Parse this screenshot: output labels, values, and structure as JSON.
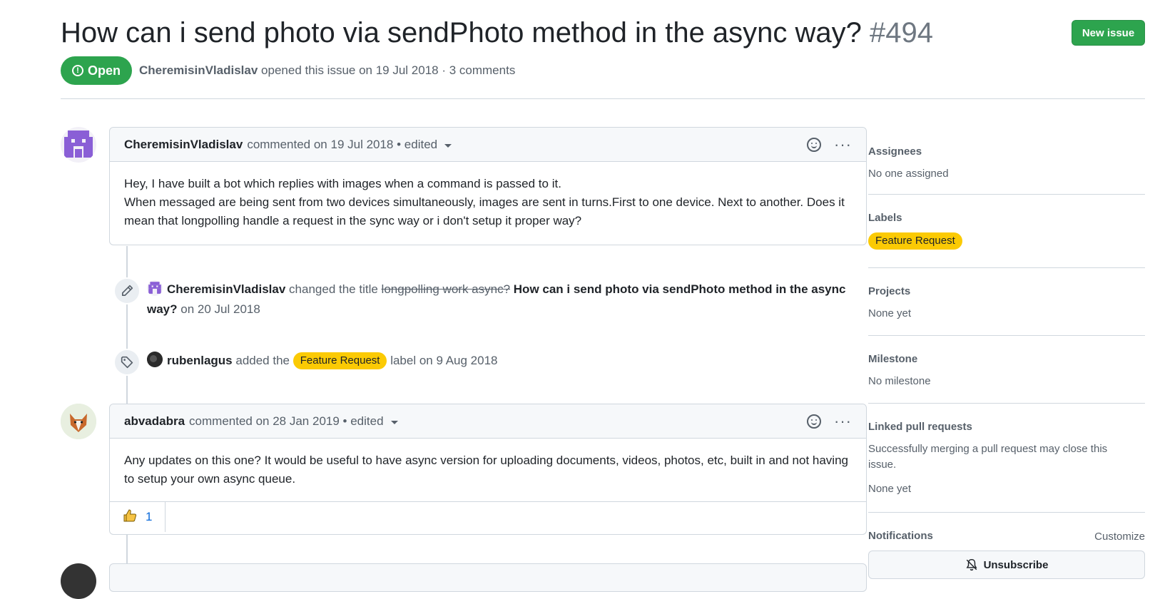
{
  "issue": {
    "title": "How can i send photo via sendPhoto method in the async way?",
    "number": "#494",
    "new_issue_label": "New issue",
    "state": "Open",
    "author": "CheremisinVladislav",
    "opened_text": "opened this issue on 19 Jul 2018 · 3 comments"
  },
  "timeline": {
    "comment1": {
      "author": "CheremisinVladislav",
      "meta": "commented on 19 Jul 2018 • edited",
      "line1": "Hey, I have built a bot which replies with images when a command is passed to it.",
      "line2": "When messaged are being sent from two devices simultaneously, images are sent in turns.First to one device. Next to another. Does it mean that longpolling handle a request in the sync way or i don't setup it proper way?"
    },
    "event_rename": {
      "author": "CheremisinVladislav",
      "action": "changed the title",
      "old_title": "longpolling work async?",
      "new_title": "How can i send photo via sendPhoto method in the async way?",
      "date": "on 20 Jul 2018"
    },
    "event_label": {
      "author": "rubenlagus",
      "action": "added the",
      "label": "Feature Request",
      "suffix": "label on 9 Aug 2018"
    },
    "comment2": {
      "author": "abvadabra",
      "meta": "commented on 28 Jan 2019 • edited",
      "body": "Any updates on this one? It would be useful to have async version for uploading documents, videos, photos, etc, built in and not having to setup your own async queue.",
      "reaction_count": "1"
    }
  },
  "sidebar": {
    "assignees": {
      "heading": "Assignees",
      "value": "No one assigned"
    },
    "labels": {
      "heading": "Labels",
      "label": "Feature Request"
    },
    "projects": {
      "heading": "Projects",
      "value": "None yet"
    },
    "milestone": {
      "heading": "Milestone",
      "value": "No milestone"
    },
    "linked_prs": {
      "heading": "Linked pull requests",
      "note": "Successfully merging a pull request may close this issue.",
      "value": "None yet"
    },
    "notifications": {
      "heading": "Notifications",
      "customize": "Customize",
      "unsubscribe": "Unsubscribe"
    }
  },
  "colors": {
    "green": "#2da44e",
    "label_yellow": "#fbca04",
    "link_blue": "#0969da"
  }
}
